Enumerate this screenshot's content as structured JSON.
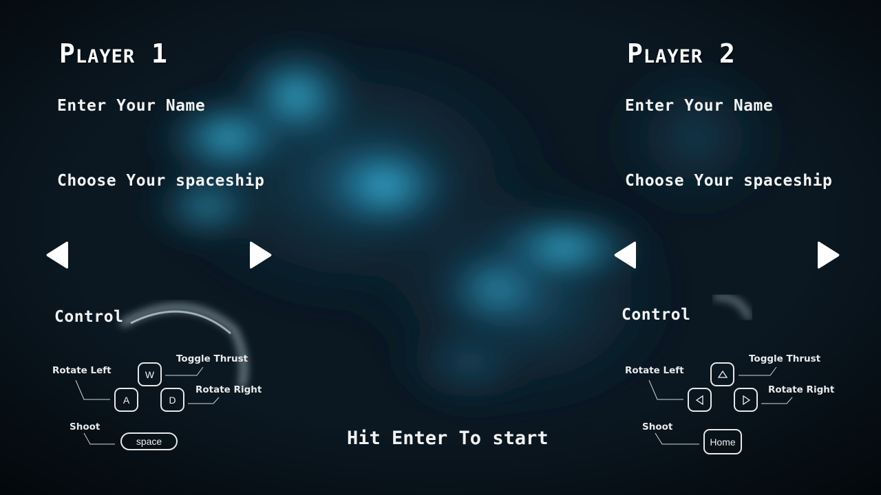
{
  "player1": {
    "title": "Player 1",
    "name_label": "Enter Your Name",
    "ship_label": "Choose Your spaceship",
    "control_label": "Control",
    "controls": {
      "rotate_left": "Rotate Left",
      "toggle_thrust": "Toggle Thrust",
      "rotate_right": "Rotate Right",
      "shoot": "Shoot",
      "key_thrust": "W",
      "key_left": "A",
      "key_right": "D",
      "key_shoot": "space"
    }
  },
  "player2": {
    "title": "Player 2",
    "name_label": "Enter Your Name",
    "ship_label": "Choose Your spaceship",
    "control_label": "Control",
    "controls": {
      "rotate_left": "Rotate Left",
      "toggle_thrust": "Toggle Thrust",
      "rotate_right": "Rotate Right",
      "shoot": "Shoot",
      "key_thrust_icon": "triangle-up-icon",
      "key_left_icon": "triangle-left-icon",
      "key_right_icon": "triangle-right-icon",
      "key_shoot": "Home"
    }
  },
  "start_prompt": "Hit Enter To start",
  "icons": {
    "prev_ship": "chevron-left-icon",
    "next_ship": "chevron-right-icon"
  },
  "colors": {
    "nebula": "#2aa6d0",
    "background": "#0a141c",
    "text": "#ffffff"
  }
}
